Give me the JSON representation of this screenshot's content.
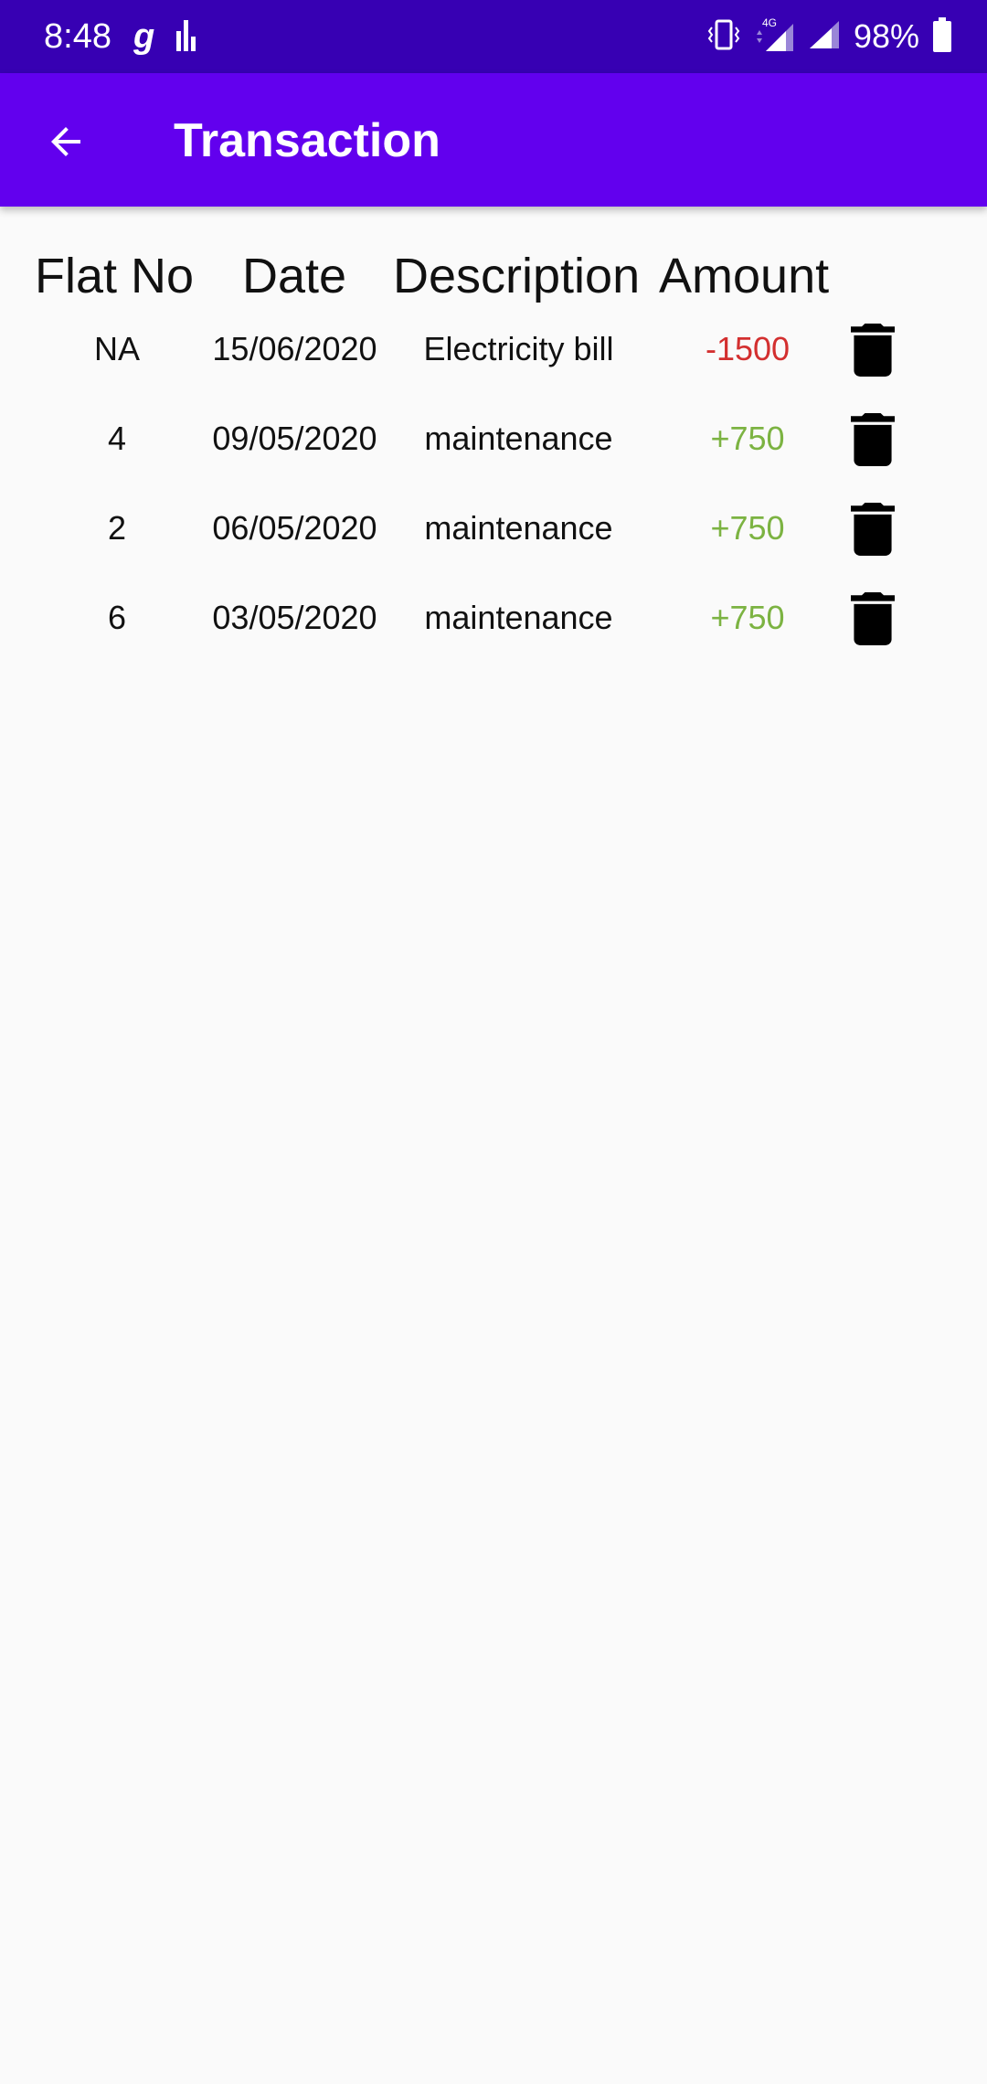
{
  "status_bar": {
    "time": "8:48",
    "battery": "98%",
    "icons": [
      "g-icon",
      "bars-icon",
      "vibrate-icon",
      "signal-4g-icon",
      "signal-icon",
      "battery-icon"
    ]
  },
  "app_bar": {
    "title": "Transaction",
    "back_icon": "arrow-back-icon"
  },
  "table": {
    "headers": {
      "flat_no": "Flat No",
      "date": "Date",
      "description": "Description",
      "amount": "Amount"
    },
    "rows": [
      {
        "flat_no": "NA",
        "date": "15/06/2020",
        "description": "Electricity bill",
        "amount": "-1500",
        "amount_color": "#d32f2f"
      },
      {
        "flat_no": "4",
        "date": "09/05/2020",
        "description": "maintenance",
        "amount": "+750",
        "amount_color": "#7cb342"
      },
      {
        "flat_no": "2",
        "date": "06/05/2020",
        "description": "maintenance",
        "amount": "+750",
        "amount_color": "#7cb342"
      },
      {
        "flat_no": "6",
        "date": "03/05/2020",
        "description": "maintenance",
        "amount": "+750",
        "amount_color": "#7cb342"
      }
    ],
    "delete_icon": "trash-icon"
  },
  "colors": {
    "status_bar": "#3700b3",
    "app_bar": "#6200ee",
    "negative": "#d32f2f",
    "positive": "#7cb342"
  }
}
